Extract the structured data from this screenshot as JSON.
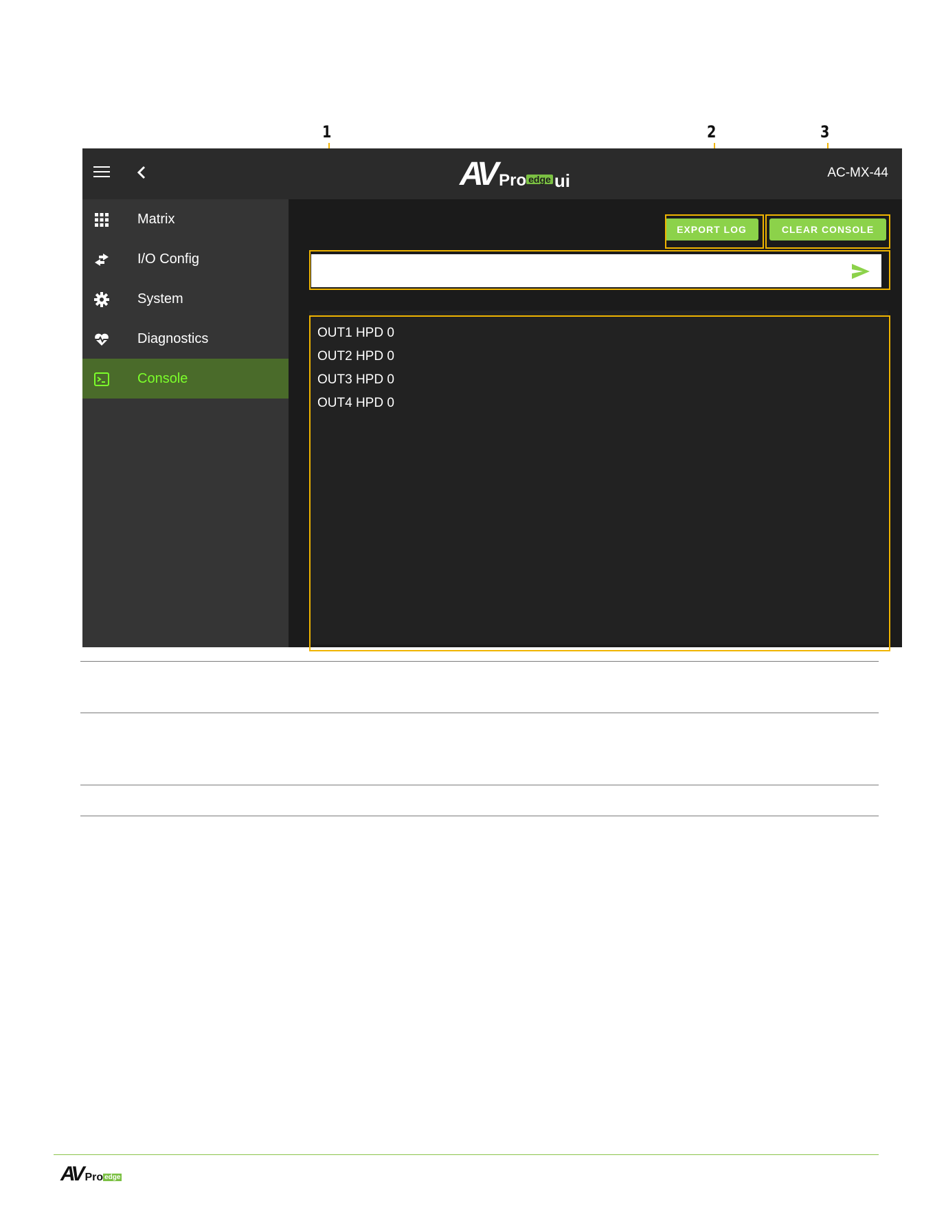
{
  "callouts": [
    "1",
    "2",
    "3"
  ],
  "header": {
    "brand_av": "AV",
    "brand_pro": "Pro",
    "brand_edge": "edge",
    "brand_ui": "ui",
    "device": "AC-MX-44"
  },
  "sidebar": {
    "items": [
      {
        "label": "Matrix",
        "icon": "grid-icon",
        "active": false
      },
      {
        "label": "I/O Config",
        "icon": "swap-arrows-icon",
        "active": false
      },
      {
        "label": "System",
        "icon": "gear-icon",
        "active": false
      },
      {
        "label": "Diagnostics",
        "icon": "heartbeat-icon",
        "active": false
      },
      {
        "label": "Console",
        "icon": "terminal-icon",
        "active": true
      }
    ]
  },
  "toolbar": {
    "export_label": "EXPORT LOG",
    "clear_label": "CLEAR CONSOLE"
  },
  "command": {
    "value": "",
    "placeholder": ""
  },
  "console": {
    "lines": [
      "OUT1 HPD 0",
      "OUT2 HPD 0",
      "OUT3 HPD 0",
      "OUT4 HPD 0"
    ]
  },
  "footer": {
    "brand_av": "AV",
    "brand_pro": "Pro",
    "brand_edge": "edge"
  },
  "colors": {
    "accent": "#8cd24a",
    "active_nav_bg": "#4a6b2a",
    "active_nav_text": "#7cff2a",
    "highlight": "#f0b400"
  }
}
